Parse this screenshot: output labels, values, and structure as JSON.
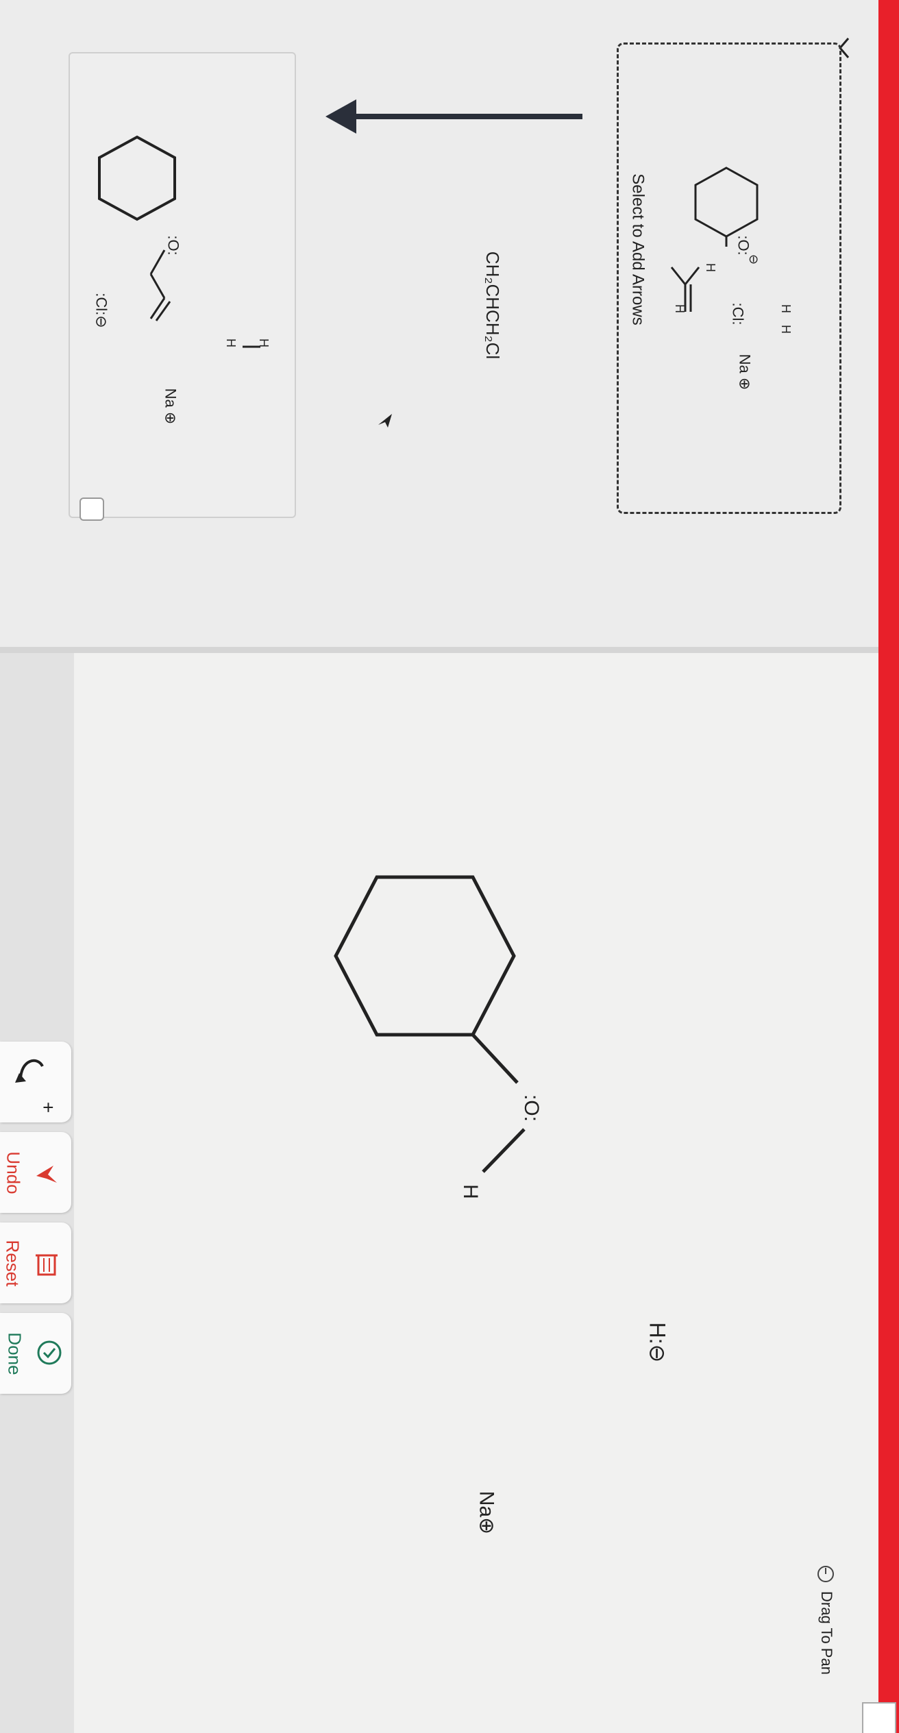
{
  "reaction_panel": {
    "select_label": "Select to Add Arrows",
    "reagent_formula": "CH₂CHCH₂Cl",
    "hydride_label": "H",
    "cl_label": ":Cl:",
    "o_label": ":O:",
    "neg_charge": "⊖",
    "sodium_label": "Na ⊕",
    "h_label": "H"
  },
  "product_panel": {
    "o_label": ":O:",
    "chloride_label": ":Cl:⊖",
    "sodium_label": "Na ⊕",
    "h_label": "H"
  },
  "workspace": {
    "alcohol_o_label": ":O:",
    "alcohol_h_label": "H",
    "hydride_ion_label": "H:⊖",
    "sodium_ion_label": "Na⊕"
  },
  "toolbar": {
    "add_arrow_symbol": "+",
    "undo_label": "Undo",
    "reset_label": "Reset",
    "done_label": "Done"
  },
  "footer": {
    "drag_to_pan_label": "Drag To Pan"
  },
  "colors": {
    "undo": "#d93a30",
    "reset": "#d93a30",
    "done": "#1f7a5a",
    "red_edge": "#e8202a"
  }
}
